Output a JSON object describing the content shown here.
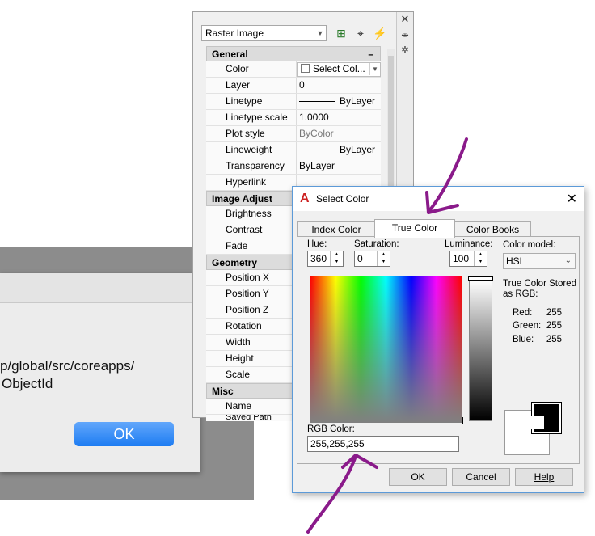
{
  "mac_dialog": {
    "message_line1": "p/global/src/coreapps/",
    "message_line2": "ObjectId",
    "ok_label": "OK"
  },
  "palette": {
    "object_type": "Raster Image",
    "sections": {
      "general": "General",
      "image_adjust": "Image Adjust",
      "geometry": "Geometry",
      "misc": "Misc"
    },
    "collapse_glyph": "–",
    "general_rows": {
      "color_key": "Color",
      "color_value": "Select Col...",
      "layer_key": "Layer",
      "layer_value": "0",
      "linetype_key": "Linetype",
      "linetype_value": "ByLayer",
      "linetype_scale_key": "Linetype scale",
      "linetype_scale_value": "1.0000",
      "plot_style_key": "Plot style",
      "plot_style_value": "ByColor",
      "lineweight_key": "Lineweight",
      "lineweight_value": "ByLayer",
      "transparency_key": "Transparency",
      "transparency_value": "ByLayer",
      "hyperlink_key": "Hyperlink"
    },
    "image_adjust_rows": {
      "brightness": "Brightness",
      "contrast": "Contrast",
      "fade": "Fade"
    },
    "geometry_rows": {
      "position_x": "Position X",
      "position_y": "Position Y",
      "position_z": "Position Z",
      "rotation": "Rotation",
      "width": "Width",
      "height": "Height",
      "scale": "Scale"
    },
    "misc_rows": {
      "name": "Name",
      "saved_path": "Saved Path"
    }
  },
  "select_color": {
    "title": "Select Color",
    "tabs": {
      "index": "Index Color",
      "true": "True Color",
      "books": "Color Books"
    },
    "hue_label": "Hue:",
    "hue_value": "360",
    "saturation_label": "Saturation:",
    "saturation_value": "0",
    "luminance_label": "Luminance:",
    "luminance_value": "100",
    "model_label": "Color model:",
    "model_value": "HSL",
    "stored_line1": "True Color Stored",
    "stored_line2": "as RGB:",
    "red_label": "Red:",
    "red_value": "255",
    "green_label": "Green:",
    "green_value": "255",
    "blue_label": "Blue:",
    "blue_value": "255",
    "rgb_label": "RGB Color:",
    "rgb_value": "255,255,255",
    "ok": "OK",
    "cancel": "Cancel",
    "help": "Help"
  },
  "colors": {
    "annotation": "#8a1a8a",
    "accent": "#1d7cf2"
  }
}
